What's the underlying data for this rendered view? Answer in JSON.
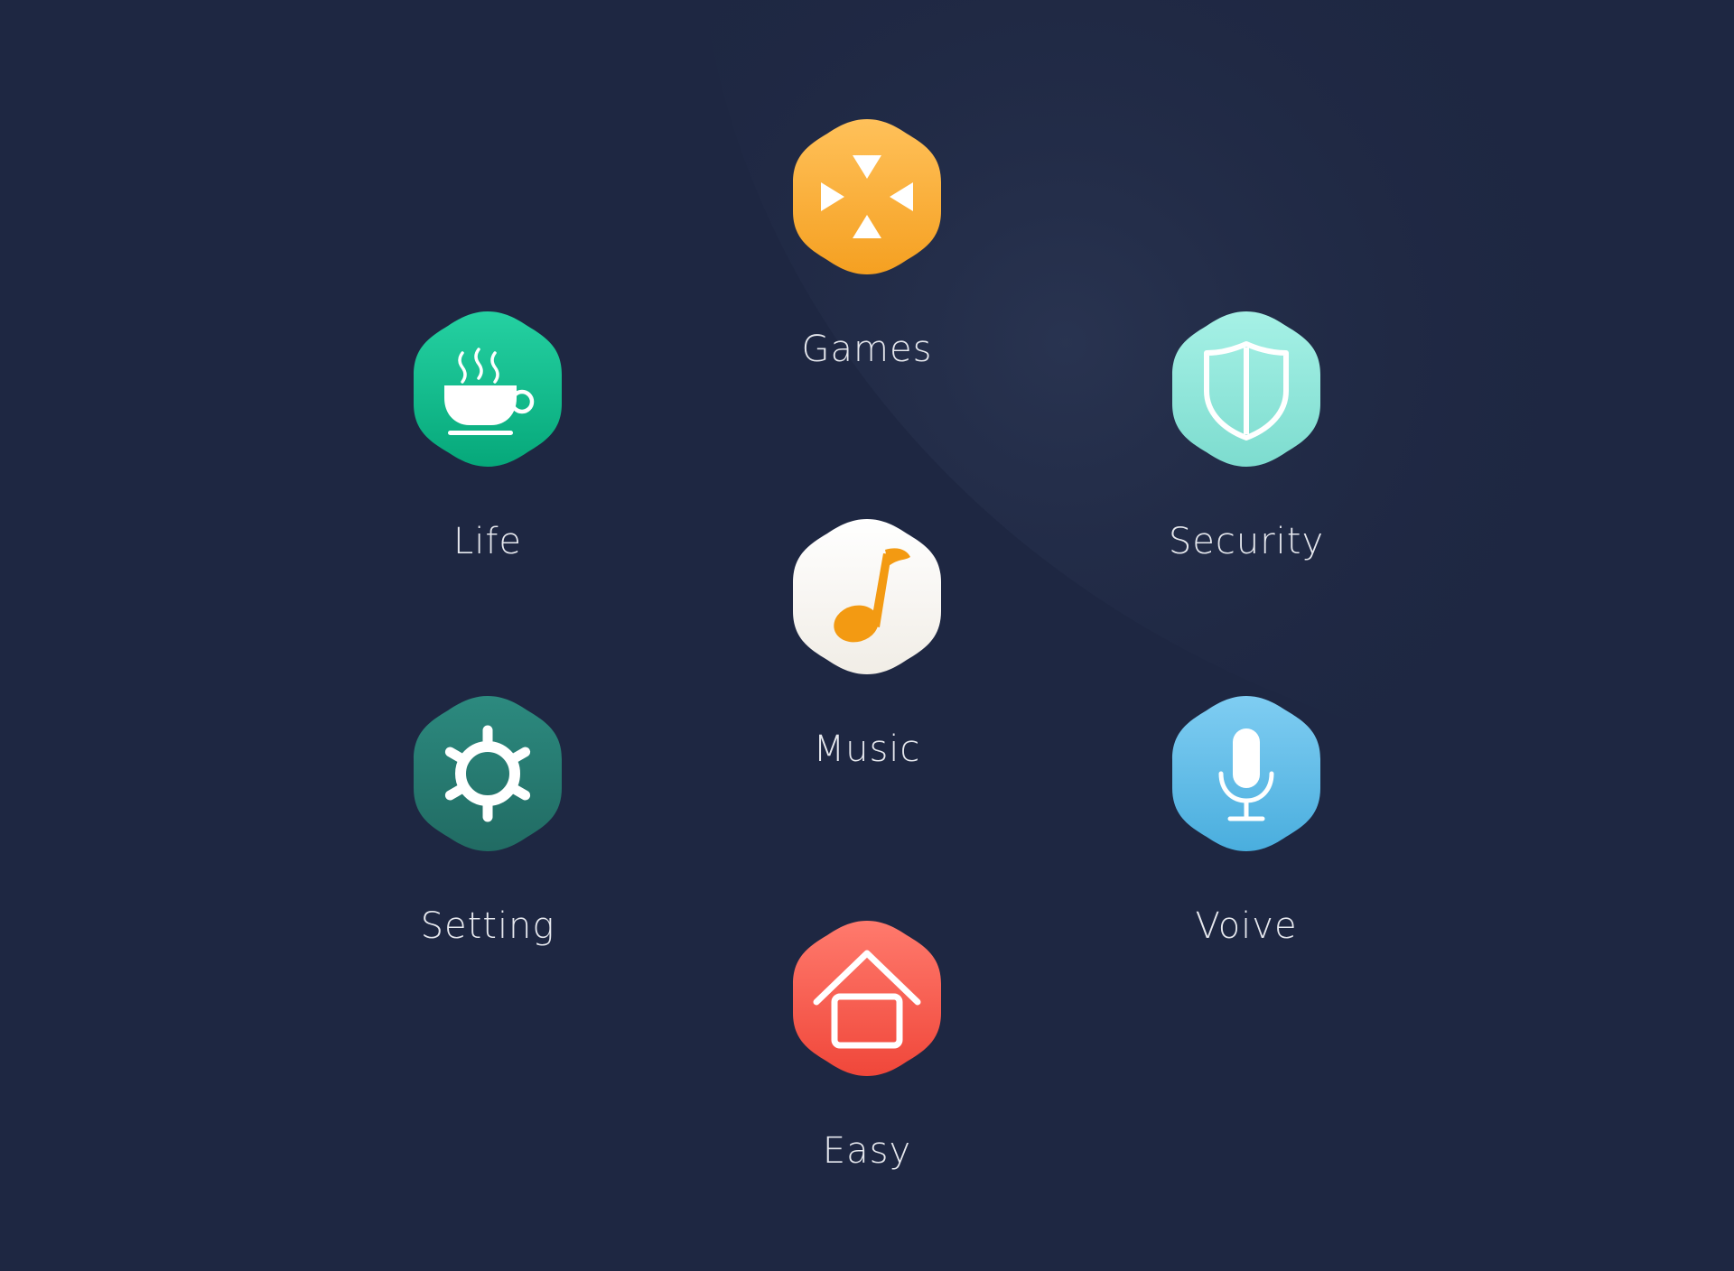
{
  "background": {
    "color": "#1e2742"
  },
  "apps": [
    {
      "id": "games",
      "label": "Games",
      "icon": "gamepad-icon",
      "colors": [
        "#ffc15a",
        "#f5a021"
      ]
    },
    {
      "id": "life",
      "label": "Life",
      "icon": "coffee-cup-icon",
      "colors": [
        "#25d1a2",
        "#06a87a"
      ]
    },
    {
      "id": "security",
      "label": "Security",
      "icon": "shield-icon",
      "colors": [
        "#a6f1e6",
        "#7ddccf"
      ]
    },
    {
      "id": "music",
      "label": "Music",
      "icon": "music-note-icon",
      "colors": [
        "#ffffff",
        "#f1ede6"
      ],
      "accent": "#f39a12"
    },
    {
      "id": "setting",
      "label": "Setting",
      "icon": "gear-icon",
      "colors": [
        "#2c8a7f",
        "#216b63"
      ]
    },
    {
      "id": "voice",
      "label": "Voive",
      "icon": "microphone-icon",
      "colors": [
        "#7fcdf2",
        "#4aaede"
      ]
    },
    {
      "id": "easy",
      "label": "Easy",
      "icon": "home-icon",
      "colors": [
        "#ff7a6d",
        "#f0473a"
      ]
    }
  ]
}
